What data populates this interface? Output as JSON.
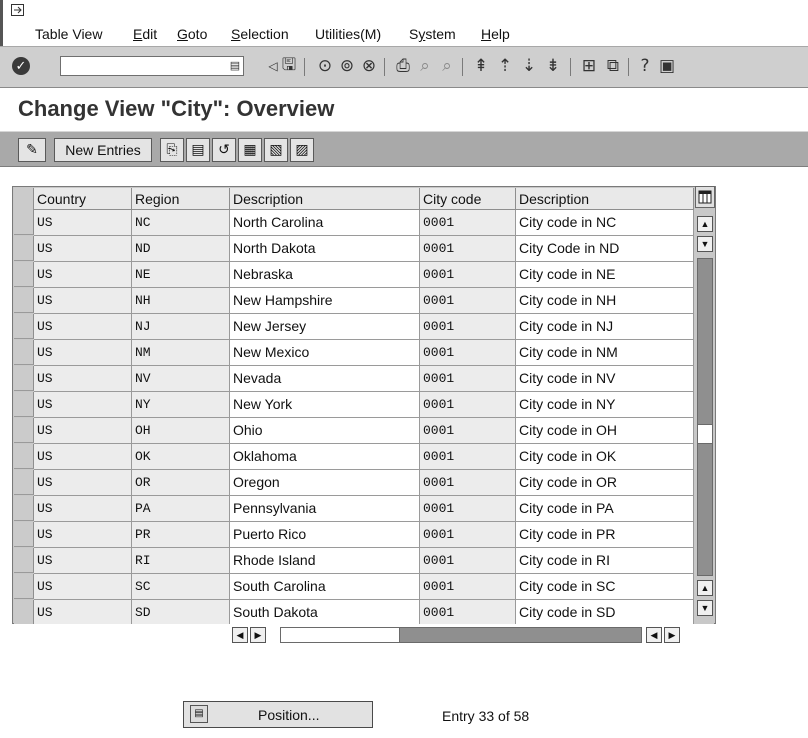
{
  "menu": {
    "items": [
      {
        "label": "Table View",
        "underline": ""
      },
      {
        "label": "Edit",
        "underline": "E"
      },
      {
        "label": "Goto",
        "underline": "G"
      },
      {
        "label": "Selection",
        "underline": "S"
      },
      {
        "label": "Utilities(M)",
        "underline": ""
      },
      {
        "label": "System",
        "underline": "y"
      },
      {
        "label": "Help",
        "underline": "H"
      }
    ]
  },
  "toolbar": {
    "command_value": "",
    "icons": [
      "enter-icon",
      "back-icon",
      "save-icon",
      "back-nav-icon",
      "exit-icon",
      "cancel-icon",
      "print-icon",
      "find-icon",
      "find-next-icon",
      "first-page-icon",
      "previous-page-icon",
      "next-page-icon",
      "last-page-icon",
      "create-session-icon",
      "shortcut-icon",
      "help-icon",
      "layout-icon"
    ]
  },
  "title": "Change View \"City\": Overview",
  "app_toolbar": {
    "new_entries_label": "New Entries",
    "icons": [
      "display-change-icon",
      "copy-as-icon",
      "delete-icon",
      "undo-change-icon",
      "select-all-icon",
      "select-block-icon",
      "deselect-all-icon"
    ]
  },
  "table": {
    "headers": [
      "Country",
      "Region",
      "Description",
      "City code",
      "Description"
    ],
    "rows": [
      [
        "US",
        "NC",
        "North Carolina",
        "0001",
        "City code in NC"
      ],
      [
        "US",
        "ND",
        "North Dakota",
        "0001",
        "City Code in ND"
      ],
      [
        "US",
        "NE",
        "Nebraska",
        "0001",
        "City code in NE"
      ],
      [
        "US",
        "NH",
        "New Hampshire",
        "0001",
        "City code in NH"
      ],
      [
        "US",
        "NJ",
        "New Jersey",
        "0001",
        "City code in NJ"
      ],
      [
        "US",
        "NM",
        "New Mexico",
        "0001",
        "City code in NM"
      ],
      [
        "US",
        "NV",
        "Nevada",
        "0001",
        "City code in NV"
      ],
      [
        "US",
        "NY",
        "New York",
        "0001",
        "City code in NY"
      ],
      [
        "US",
        "OH",
        "Ohio",
        "0001",
        "City code in OH"
      ],
      [
        "US",
        "OK",
        "Oklahoma",
        "0001",
        "City code in OK"
      ],
      [
        "US",
        "OR",
        "Oregon",
        "0001",
        "City code in OR"
      ],
      [
        "US",
        "PA",
        "Pennsylvania",
        "0001",
        "City code in PA"
      ],
      [
        "US",
        "PR",
        "Puerto Rico",
        "0001",
        "City code in PR"
      ],
      [
        "US",
        "RI",
        "Rhode Island",
        "0001",
        "City code in RI"
      ],
      [
        "US",
        "SC",
        "South Carolina",
        "0001",
        "City code in SC"
      ],
      [
        "US",
        "SD",
        "South Dakota",
        "0001",
        "City code in SD"
      ]
    ]
  },
  "footer": {
    "position_label": "Position...",
    "entry_text": "Entry 33 of 58"
  }
}
